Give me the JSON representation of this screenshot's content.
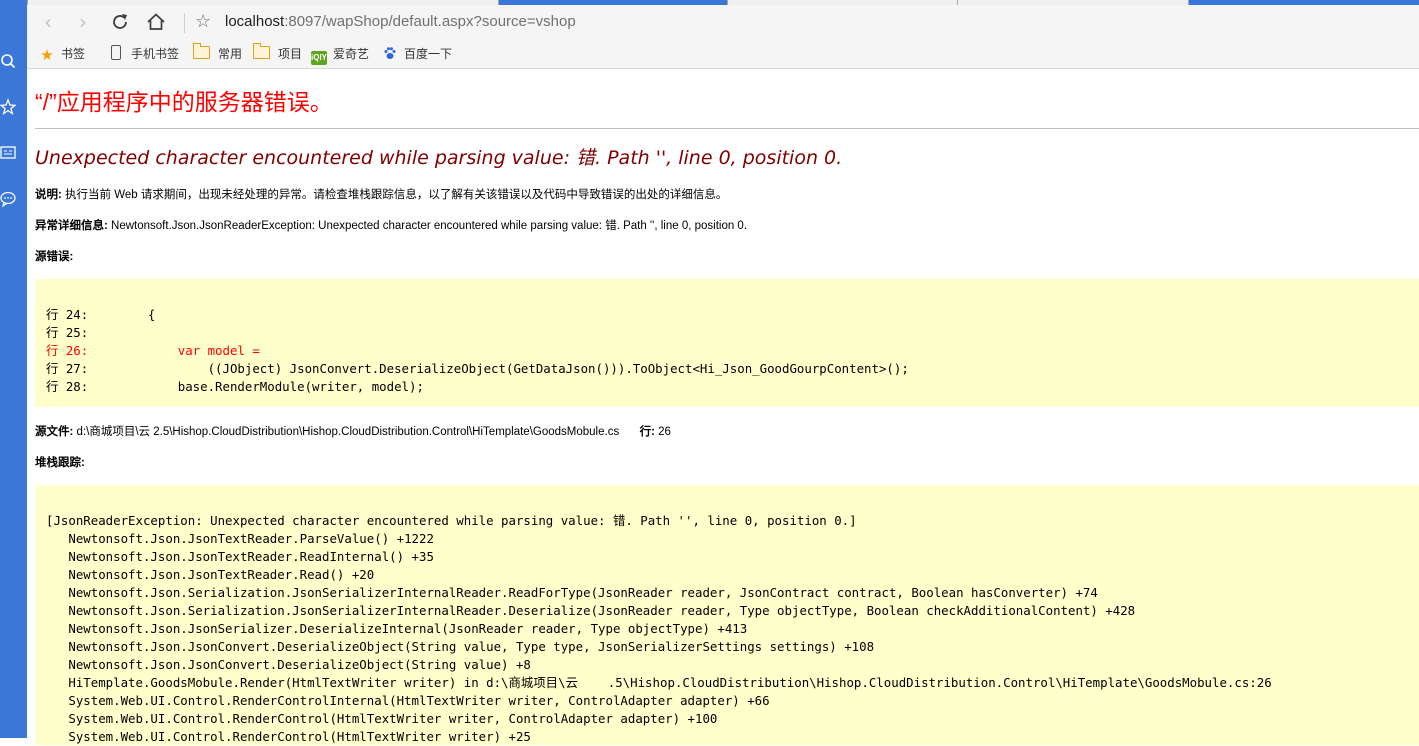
{
  "browser": {
    "address": {
      "host": "localhost",
      "rest": ":8097/wapShop/default.aspx?source=vshop"
    },
    "bookmarks": [
      {
        "label": "书签",
        "icon": "star-icon"
      },
      {
        "label": "手机书签",
        "icon": "phone-icon"
      },
      {
        "label": "常用",
        "icon": "folder-icon"
      },
      {
        "label": "项目",
        "icon": "folder-icon"
      },
      {
        "label": "爱奇艺",
        "icon": "iqiyi-icon"
      },
      {
        "label": "百度一下",
        "icon": "baidu-paw-icon"
      }
    ],
    "sidebar_icons": [
      "search-icon",
      "star-icon",
      "news-icon",
      "chat-icon"
    ]
  },
  "error_page": {
    "title": "“/”应用程序中的服务器错误。",
    "message": "Unexpected character encountered while parsing value: 错. Path '', line 0, position 0.",
    "description_label": "说明:",
    "description_text": "执行当前 Web 请求期间，出现未经处理的异常。请检查堆栈跟踪信息，以了解有关该错误以及代码中导致错误的出处的详细信息。",
    "exception_label": "异常详细信息:",
    "exception_text": "Newtonsoft.Json.JsonReaderException: Unexpected character encountered while parsing value: 错. Path '', line 0, position 0.",
    "source_error_label": "源错误:",
    "source_lines": [
      {
        "text": "行 24:        {",
        "error": false
      },
      {
        "text": "行 25:",
        "error": false
      },
      {
        "text": "行 26:            var model =",
        "error": true
      },
      {
        "text": "行 27:                ((JObject) JsonConvert.DeserializeObject(GetDataJson())).ToObject<Hi_Json_GoodGourpContent>();",
        "error": false
      },
      {
        "text": "行 28:            base.RenderModule(writer, model);",
        "error": false
      }
    ],
    "source_file_label": "源文件:",
    "source_file_path": "d:\\商城项目\\云    2.5\\Hishop.CloudDistribution\\Hishop.CloudDistribution.Control\\HiTemplate\\GoodsMobule.cs",
    "line_label": "行:",
    "line_value": "26",
    "stack_trace_label": "堆栈跟踪:",
    "stack_lines": [
      "[JsonReaderException: Unexpected character encountered while parsing value: 错. Path '', line 0, position 0.]",
      "   Newtonsoft.Json.JsonTextReader.ParseValue() +1222",
      "   Newtonsoft.Json.JsonTextReader.ReadInternal() +35",
      "   Newtonsoft.Json.JsonTextReader.Read() +20",
      "   Newtonsoft.Json.Serialization.JsonSerializerInternalReader.ReadForType(JsonReader reader, JsonContract contract, Boolean hasConverter) +74",
      "   Newtonsoft.Json.Serialization.JsonSerializerInternalReader.Deserialize(JsonReader reader, Type objectType, Boolean checkAdditionalContent) +428",
      "   Newtonsoft.Json.JsonSerializer.DeserializeInternal(JsonReader reader, Type objectType) +413",
      "   Newtonsoft.Json.JsonConvert.DeserializeObject(String value, Type type, JsonSerializerSettings settings) +108",
      "   Newtonsoft.Json.JsonConvert.DeserializeObject(String value) +8",
      "   HiTemplate.GoodsMobule.Render(HtmlTextWriter writer) in d:\\商城项目\\云    .5\\Hishop.CloudDistribution\\Hishop.CloudDistribution.Control\\HiTemplate\\GoodsMobule.cs:26",
      "   System.Web.UI.Control.RenderControlInternal(HtmlTextWriter writer, ControlAdapter adapter) +66",
      "   System.Web.UI.Control.RenderControl(HtmlTextWriter writer, ControlAdapter adapter) +100",
      "   System.Web.UI.Control.RenderControl(HtmlTextWriter writer) +25"
    ]
  }
}
